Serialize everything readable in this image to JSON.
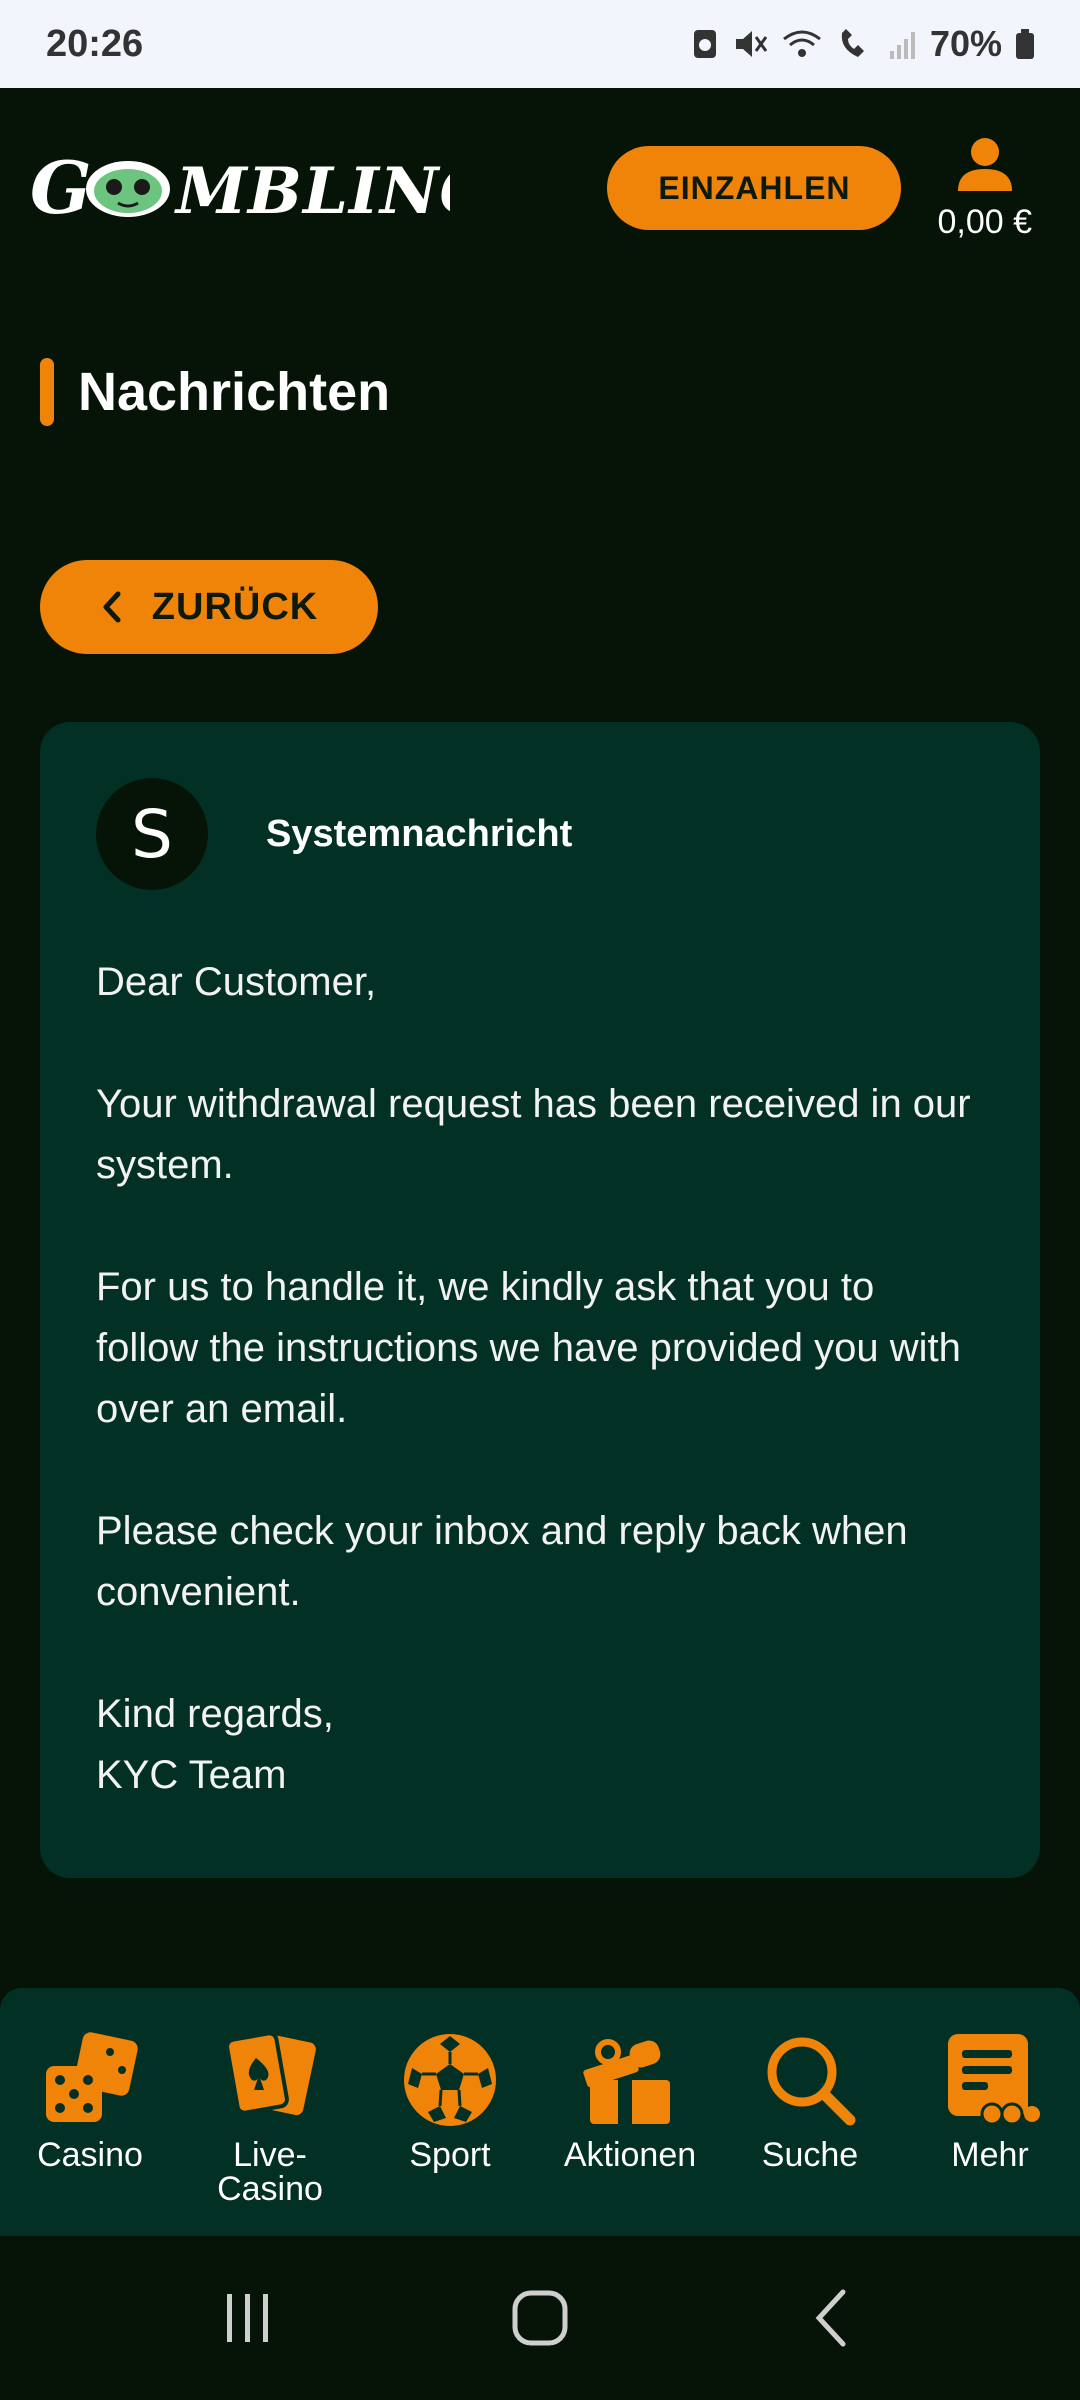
{
  "status_bar": {
    "time": "20:26",
    "battery": "70%"
  },
  "header": {
    "logo_text": "GOMBLINGO",
    "deposit_label": "EINZAHLEN",
    "balance": "0,00 €"
  },
  "page": {
    "title": "Nachrichten",
    "back_label": "ZURÜCK"
  },
  "message": {
    "avatar_letter": "S",
    "sender": "Systemnachricht",
    "paragraphs": [
      "Dear Customer,",
      "Your withdrawal request has been received in our system.",
      "For us to handle it, we kindly ask that you to follow the instructions we have provided you with over an email.",
      "Please check your inbox and reply back when convenient.",
      "Kind regards,",
      "KYC Team"
    ]
  },
  "bottom_nav": {
    "items": [
      {
        "label": "Casino",
        "icon": "dice-icon"
      },
      {
        "label": "Live-Casino",
        "icon": "cards-icon"
      },
      {
        "label": "Sport",
        "icon": "soccer-ball-icon"
      },
      {
        "label": "Aktionen",
        "icon": "gift-icon"
      },
      {
        "label": "Suche",
        "icon": "search-icon"
      },
      {
        "label": "Mehr",
        "icon": "more-icon"
      }
    ]
  },
  "colors": {
    "accent": "#f08408",
    "background": "#061408",
    "card": "#023024"
  }
}
